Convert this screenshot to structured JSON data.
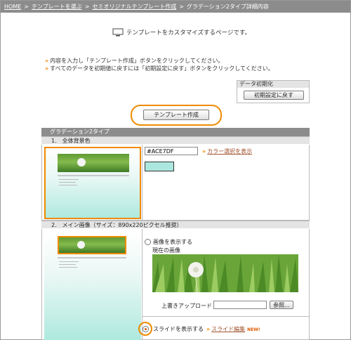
{
  "breadcrumb": {
    "home": "HOME",
    "select_template": "テンプレートを選ぶ",
    "semi_original": "セミオリジナルテンプレート作成",
    "current": "グラデーション2タイプ詳細内容",
    "separator": ">"
  },
  "intro": {
    "text": "テンプレートをカスタマイズするページです。",
    "icon": "monitor-icon"
  },
  "notes": {
    "marker": "»",
    "line1": "内容を入力し「テンプレート作成」ボタンをクリックしてください。",
    "line2": "すべてのデータを初期値に戻すには「初期設定に戻す」ボタンをクリックしてください。"
  },
  "reset_panel": {
    "heading": "データ初期化",
    "button_label": "初期設定に戻す"
  },
  "create_button_label": "テンプレート作成",
  "section": {
    "title": "グラデーション2タイプ",
    "row1": {
      "heading": "1.　全体背景色",
      "hex_value": "#ACE7DF",
      "picker_marker": "»",
      "picker_link": "カラー選択を表示",
      "swatch_color": "#ACE7DF"
    },
    "row2": {
      "heading": "2.　メイン画像（サイズ：890x220ピクセル推奨）",
      "show_image_label": "画像を表示する",
      "current_image_label": "現在の画像",
      "upload_label": "上書きアップロード",
      "browse_label": "参照...",
      "show_slide_label": "スライドを表示する",
      "slide_marker": "»",
      "slide_edit_link": "スライド編集",
      "new_badge": "NEW!"
    }
  },
  "colors": {
    "accent": "#F08A00",
    "header_gray": "#8C8C8C",
    "link": "#A0522D"
  }
}
